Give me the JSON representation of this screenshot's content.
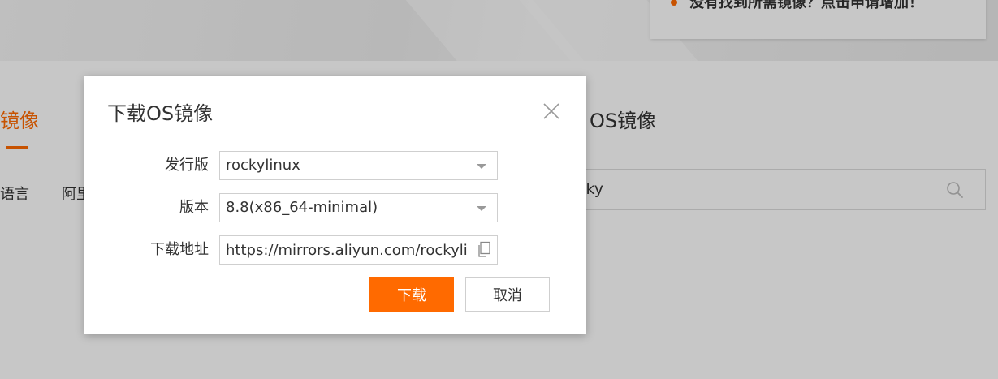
{
  "background": {
    "hint_text": "没有找到所需镜像？点击申请增加！",
    "tab_left_label": "镜像",
    "tab_right_label": "OS镜像",
    "categories": [
      "语言",
      "阿里"
    ],
    "search_value": "cky"
  },
  "dialog": {
    "title": "下载OS镜像",
    "fields": {
      "distribution": {
        "label": "发行版",
        "value": "rockylinux"
      },
      "version": {
        "label": "版本",
        "value": "8.8(x86_64-minimal)"
      },
      "download_url": {
        "label": "下载地址",
        "value": "https://mirrors.aliyun.com/rockylinu"
      }
    },
    "download_button": "下载",
    "cancel_button": "取消"
  },
  "colors": {
    "accent": "#ff6a00",
    "overlay": "rgba(0,0,0,0.22)"
  }
}
